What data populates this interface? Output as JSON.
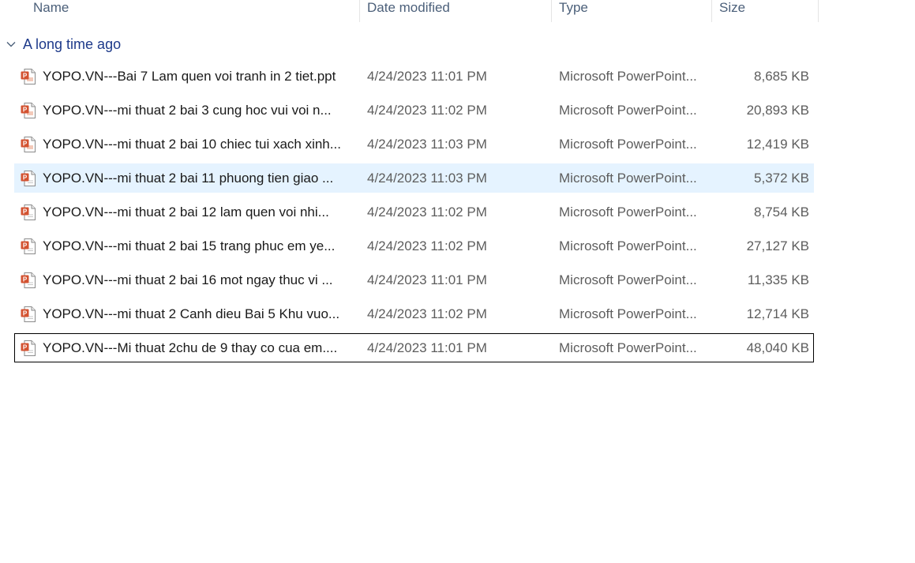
{
  "columns": {
    "name": "Name",
    "date_modified": "Date modified",
    "type": "Type",
    "size": "Size"
  },
  "group": {
    "label": "A long time ago"
  },
  "files": [
    {
      "name": "YOPO.VN---Bai 7 Lam quen voi tranh in 2 tiet.ppt",
      "date": "4/24/2023 11:01 PM",
      "type": "Microsoft PowerPoint...",
      "size": "8,685 KB",
      "icon": "ppt-legacy-file-icon"
    },
    {
      "name": "YOPO.VN---mi thuat 2 bai 3 cung hoc vui voi n...",
      "date": "4/24/2023 11:02 PM",
      "type": "Microsoft PowerPoint...",
      "size": "20,893 KB",
      "icon": "ppt-legacy-file-icon"
    },
    {
      "name": "YOPO.VN---mi thuat 2 bai 10 chiec tui xach xinh...",
      "date": "4/24/2023 11:03 PM",
      "type": "Microsoft PowerPoint...",
      "size": "12,419 KB",
      "icon": "ppt-legacy-file-icon"
    },
    {
      "name": "YOPO.VN---mi thuat 2 bai 11 phuong tien giao ...",
      "date": "4/24/2023 11:03 PM",
      "type": "Microsoft PowerPoint...",
      "size": "5,372 KB",
      "icon": "pptx-file-icon"
    },
    {
      "name": "YOPO.VN---mi thuat 2 bai 12 lam quen voi nhi...",
      "date": "4/24/2023 11:02 PM",
      "type": "Microsoft PowerPoint...",
      "size": "8,754 KB",
      "icon": "pptx-file-icon"
    },
    {
      "name": "YOPO.VN---mi thuat 2 bai 15 trang phuc em ye...",
      "date": "4/24/2023 11:02 PM",
      "type": "Microsoft PowerPoint...",
      "size": "27,127 KB",
      "icon": "pptx-file-icon"
    },
    {
      "name": "YOPO.VN---mi thuat 2 bai 16 mot ngay thuc vi ...",
      "date": "4/24/2023 11:01 PM",
      "type": "Microsoft PowerPoint...",
      "size": "11,335 KB",
      "icon": "pptx-file-icon"
    },
    {
      "name": "YOPO.VN---mi thuat 2 Canh dieu Bai 5 Khu vuo...",
      "date": "4/24/2023 11:02 PM",
      "type": "Microsoft PowerPoint...",
      "size": "12,714 KB",
      "icon": "pptx-file-icon"
    },
    {
      "name": "YOPO.VN---Mi thuat 2chu de 9 thay co cua em....",
      "date": "4/24/2023 11:01 PM",
      "type": "Microsoft PowerPoint...",
      "size": "48,040 KB",
      "icon": "pptx-file-icon"
    }
  ],
  "hovered_index": 3,
  "focused_index": 8,
  "colors": {
    "hover_bg": "#e5f3ff",
    "group_text": "#1e3a8a",
    "icon_orange": "#d35230"
  }
}
